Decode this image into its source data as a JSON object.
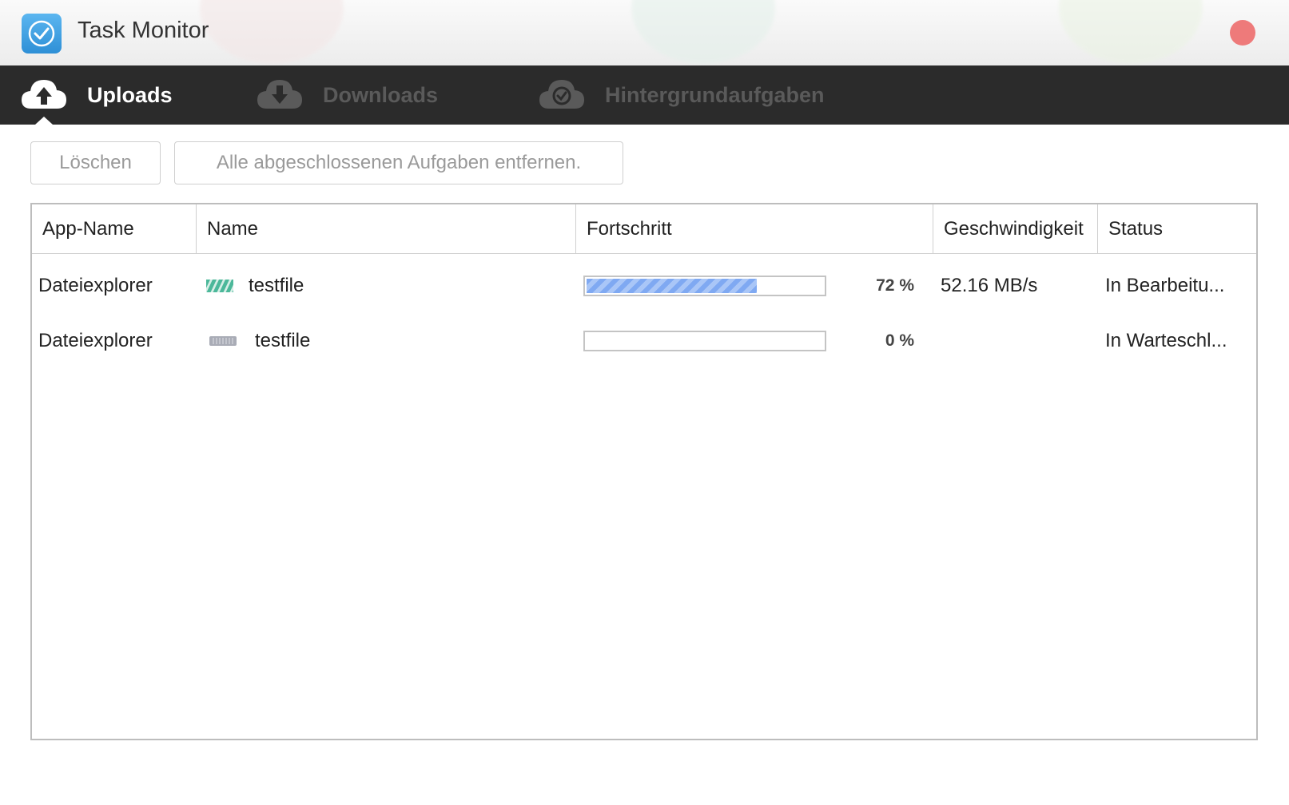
{
  "window": {
    "title": "Task Monitor"
  },
  "tabs": [
    {
      "label": "Uploads",
      "icon": "cloud-upload-icon",
      "active": true
    },
    {
      "label": "Downloads",
      "icon": "cloud-download-icon",
      "active": false
    },
    {
      "label": "Hintergrundaufgaben",
      "icon": "cloud-check-icon",
      "active": false
    }
  ],
  "toolbar": {
    "delete_label": "Löschen",
    "clear_completed_label": "Alle abgeschlossenen Aufgaben entfernen."
  },
  "table": {
    "columns": [
      "App-Name",
      "Name",
      "Fortschritt",
      "Geschwindigkeit",
      "Status"
    ],
    "rows": [
      {
        "app": "Dateiexplorer",
        "name": "testfile",
        "file_icon": "striped-file-icon",
        "progress": 72,
        "progress_label": "72 %",
        "speed": "52.16 MB/s",
        "status": "In Bearbeitu..."
      },
      {
        "app": "Dateiexplorer",
        "name": "testfile",
        "file_icon": "queued-file-icon",
        "progress": 0,
        "progress_label": "0 %",
        "speed": "",
        "status": "In Warteschl..."
      }
    ]
  },
  "colors": {
    "tabbar_bg": "#2b2b2b",
    "progress_fill": "#7fa9f2",
    "close_button": "#ee7a7a",
    "app_icon": "#3a9be0"
  }
}
